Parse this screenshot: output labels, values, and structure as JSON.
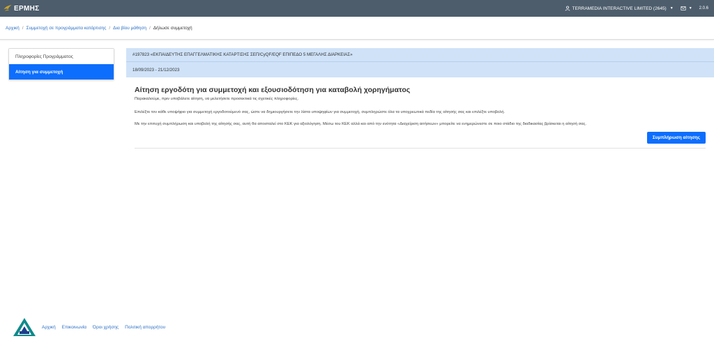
{
  "header": {
    "app_name": "ΕΡΜΗΣ",
    "user_label": "TERRAMEDIA INTERACTIVE LIMITED (2645)",
    "version": "2.0.6"
  },
  "breadcrumb": {
    "items": [
      "Αρχική",
      "Συμμετοχή σε προγράμματα κατάρτισης",
      "Δια βίου μάθηση"
    ],
    "current": "Δήλωσε συμμετοχή"
  },
  "sidebar": {
    "items": [
      {
        "label": "Πληροφορίες Προγράμματος"
      },
      {
        "label": "Αίτηση για συμμετοχή"
      }
    ]
  },
  "course": {
    "title": "#197823 «ΕΚΠΑΙΔΕΥΤΗΣ ΕΠΑΓΓΕΛΜΑΤΙΚΗΣ ΚΑΤΑΡΤΙΣΗΣ ΣΕΠ/CyQF/EQF ΕΠΙΠΕΔΟ 5 ΜΕΓΑΛΗΣ ΔΙΑΡΚΕΙΑΣ»",
    "dates": "18/09/2023 - 21/12/2023"
  },
  "main": {
    "heading": "Αίτηση εργοδότη για συμμετοχή και εξουσιοδότηση για καταβολή χορηγήματος",
    "paragraphs": [
      "Παρακαλούμε, πριν υποβάλετε αίτηση, να μελετήσετε προσεκτικά τις σχετικές πληροφορίες.",
      "Επιλέξτε τον κάθε υποψήφιο για συμμετοχή εργοδοτούμενό σας, ώστε να δημιουργήσετε την λίστα υποψηφίων για συμμετοχή, συμπληρώστε όλα τα υποχρεωτικά πεδία της αίτησής σας και επιλέξτε υποβολή.",
      "Με την επιτυχή συμπλήρωση και υποβολή της αίτησής σας, αυτή θα αποσταλεί στο ΚΕΚ για αξιολόγηση. Μέσω του ΚΕΚ αλλά και από την ενότητα «Διαχείριση αιτήσεων» μπορείτε να ενημερώνεστε σε ποιο στάδιο της διαδικασίας βρίσκεται η αίτησή σας."
    ],
    "submit_button": "Συμπλήρωση αίτησης"
  },
  "footer": {
    "links": [
      "Αρχική",
      "Επικοινωνία",
      "Όροι χρήσης",
      "Πολιτική απορρήτου"
    ]
  },
  "colors": {
    "topbar": "#4d5d6c",
    "accent": "#0d6efd",
    "course_card": "#cfe2f8",
    "link": "#2c6fc4"
  }
}
